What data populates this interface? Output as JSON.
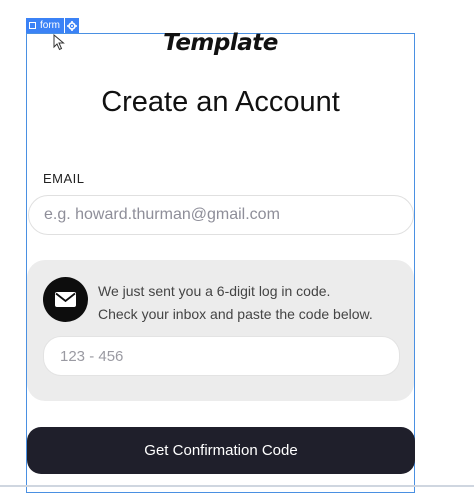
{
  "editor": {
    "selection_label": "form",
    "selection_icon": "square-outline-icon",
    "settings_icon": "gear-icon",
    "accent_color": "#3b82f6"
  },
  "brand": {
    "logo_text": "Template"
  },
  "page": {
    "title": "Create an Account"
  },
  "email": {
    "label": "EMAIL",
    "placeholder": "e.g. howard.thurman@gmail.com",
    "value": ""
  },
  "verification": {
    "icon": "mail-icon",
    "line1": "We just sent you a 6-digit log in code.",
    "line2": "Check your inbox and paste the code below.",
    "code_placeholder": "123 - 456",
    "code_value": ""
  },
  "actions": {
    "submit_label": "Get Confirmation Code"
  },
  "colors": {
    "button_bg": "#1f1f2b",
    "panel_bg": "#ececec",
    "text_primary": "#111111"
  }
}
